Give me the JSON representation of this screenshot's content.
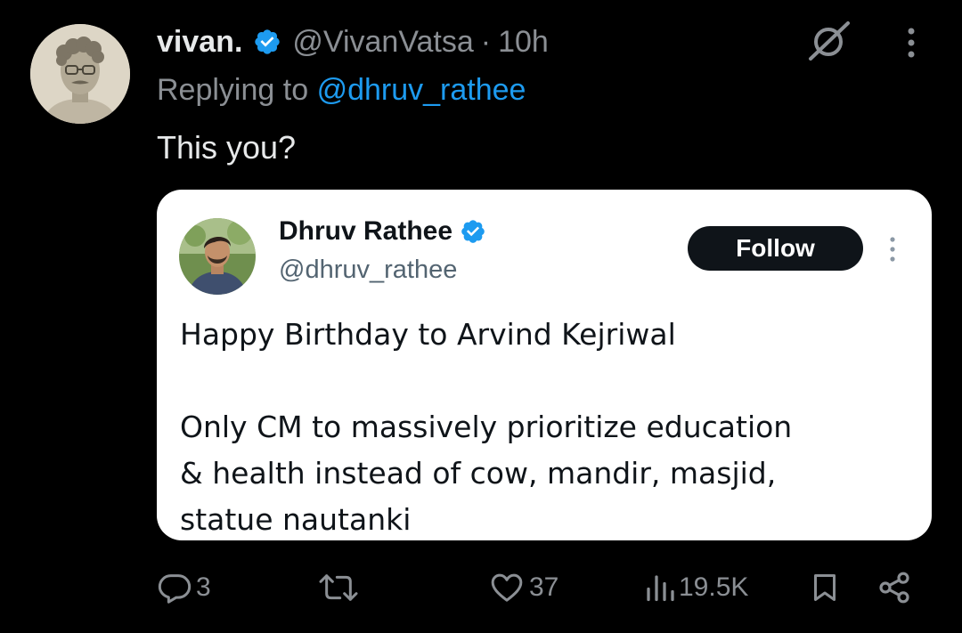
{
  "tweet": {
    "display_name": "vivan.",
    "handle": "@VivanVatsa",
    "separator": "·",
    "time": "10h",
    "replying_prefix": "Replying to",
    "replying_mention": "@dhruv_rathee",
    "text": "This you?"
  },
  "quote": {
    "display_name": "Dhruv Rathee",
    "handle": "@dhruv_rathee",
    "follow_label": "Follow",
    "text_line1": "Happy Birthday to Arvind Kejriwal",
    "text_para2": "Only CM to massively prioritize education\n& health instead of cow, mandir, masjid,\nstatue nautanki"
  },
  "actions": {
    "replies": "3",
    "likes": "37",
    "views": "19.5K"
  },
  "colors": {
    "background": "#000000",
    "accent": "#1d9bf0",
    "muted": "#8b8f94",
    "quote_background": "#ffffff"
  },
  "icons": {
    "verified": "verified-badge-icon",
    "grok": "grok-icon",
    "more": "more-vertical-icon",
    "reply": "reply-icon",
    "retweet": "retweet-icon",
    "like": "heart-icon",
    "views": "views-icon",
    "bookmark": "bookmark-icon",
    "share": "share-icon"
  }
}
